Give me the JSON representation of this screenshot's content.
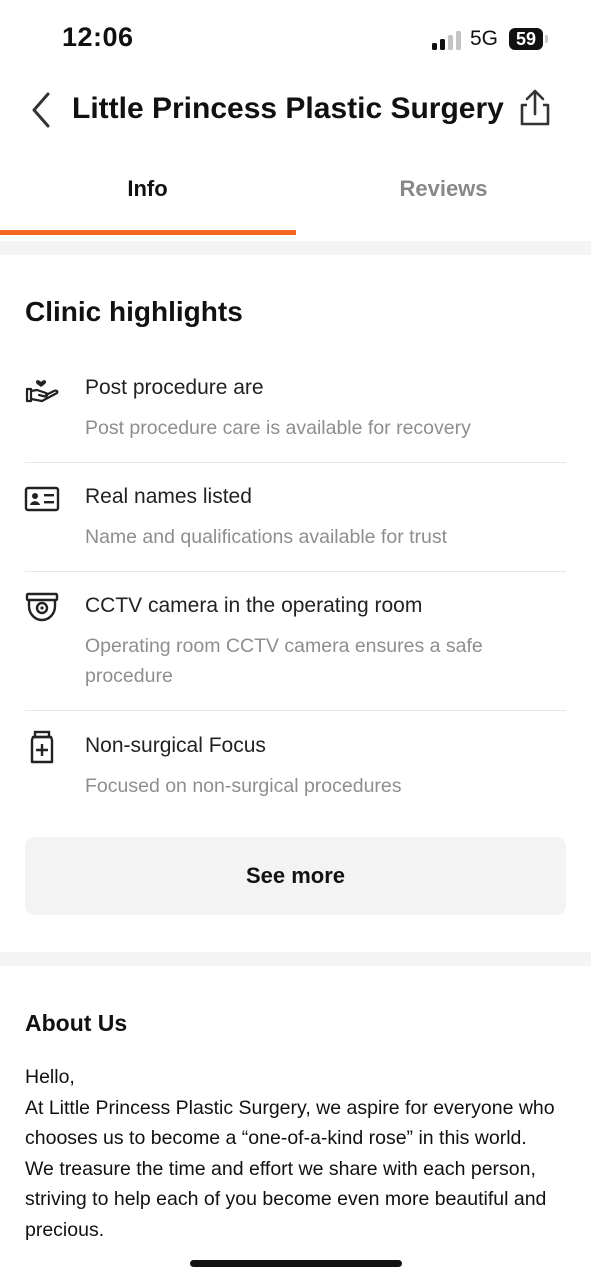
{
  "status_bar": {
    "time": "12:06",
    "network": "5G",
    "battery": "59"
  },
  "header": {
    "title": "Little Princess Plastic Surgery",
    "back_icon": "chevron-left-icon",
    "share_icon": "share-icon"
  },
  "tabs": [
    {
      "label": "Info",
      "selected": true
    },
    {
      "label": "Reviews",
      "selected": false
    }
  ],
  "colors": {
    "accent": "#f26722",
    "muted_text": "#8e8e8e",
    "button_bg": "#f3f3f3"
  },
  "highlights": {
    "title": "Clinic highlights",
    "items": [
      {
        "icon": "hand-heart-icon",
        "title": "Post procedure are",
        "description": "Post procedure care is available for recovery"
      },
      {
        "icon": "id-card-icon",
        "title": "Real names listed",
        "description": "Name and qualifications available for trust"
      },
      {
        "icon": "cctv-camera-icon",
        "title": "CCTV camera in the operating room",
        "description": "Operating room CCTV camera ensures a safe procedure"
      },
      {
        "icon": "medicine-bottle-icon",
        "title": "Non-surgical Focus",
        "description": "Focused on non-surgical procedures"
      }
    ],
    "see_more_label": "See more"
  },
  "about": {
    "title": "About Us",
    "paragraphs": [
      "Hello,",
      "At Little Princess Plastic Surgery, we aspire for everyone who chooses us to become a “one-of-a-kind rose” in this world.",
      "We treasure the time and effort we share with each person, striving to help each of you become even more beautiful and precious."
    ]
  }
}
